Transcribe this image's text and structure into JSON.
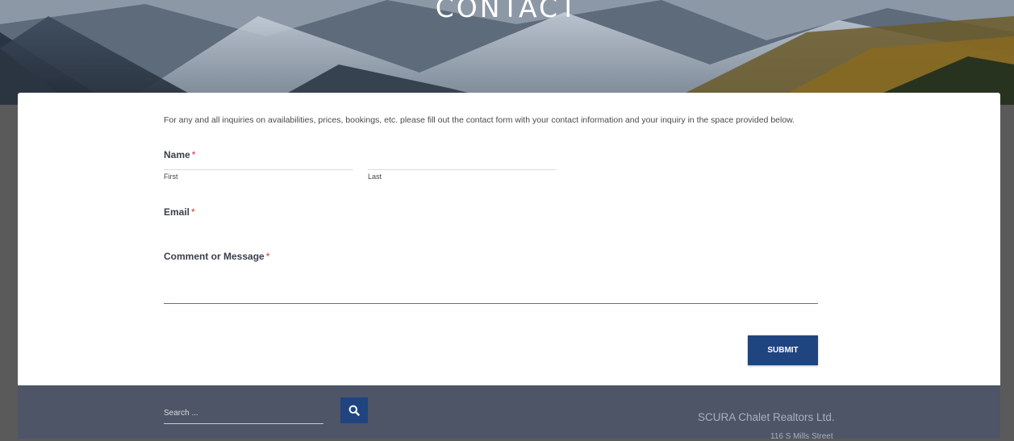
{
  "hero": {
    "title": "CONTACT"
  },
  "form": {
    "intro": "For any and all inquiries on availabilities, prices, bookings, etc. please fill out the contact form with your contact information and your inquiry in the space provided below.",
    "name_label": "Name",
    "required_mark": "*",
    "first_sublabel": "First",
    "last_sublabel": "Last",
    "email_label": "Email",
    "message_label": "Comment or Message",
    "submit_label": "SUBMIT"
  },
  "footer": {
    "search_placeholder": "Search ...",
    "search_icon": "search-icon",
    "company": "SCURA Chalet Realtors Ltd.",
    "address": "116 S Mills Street"
  },
  "colors": {
    "accent": "#1f4480",
    "required": "#d0312d",
    "footer_bg": "#4d5567"
  }
}
